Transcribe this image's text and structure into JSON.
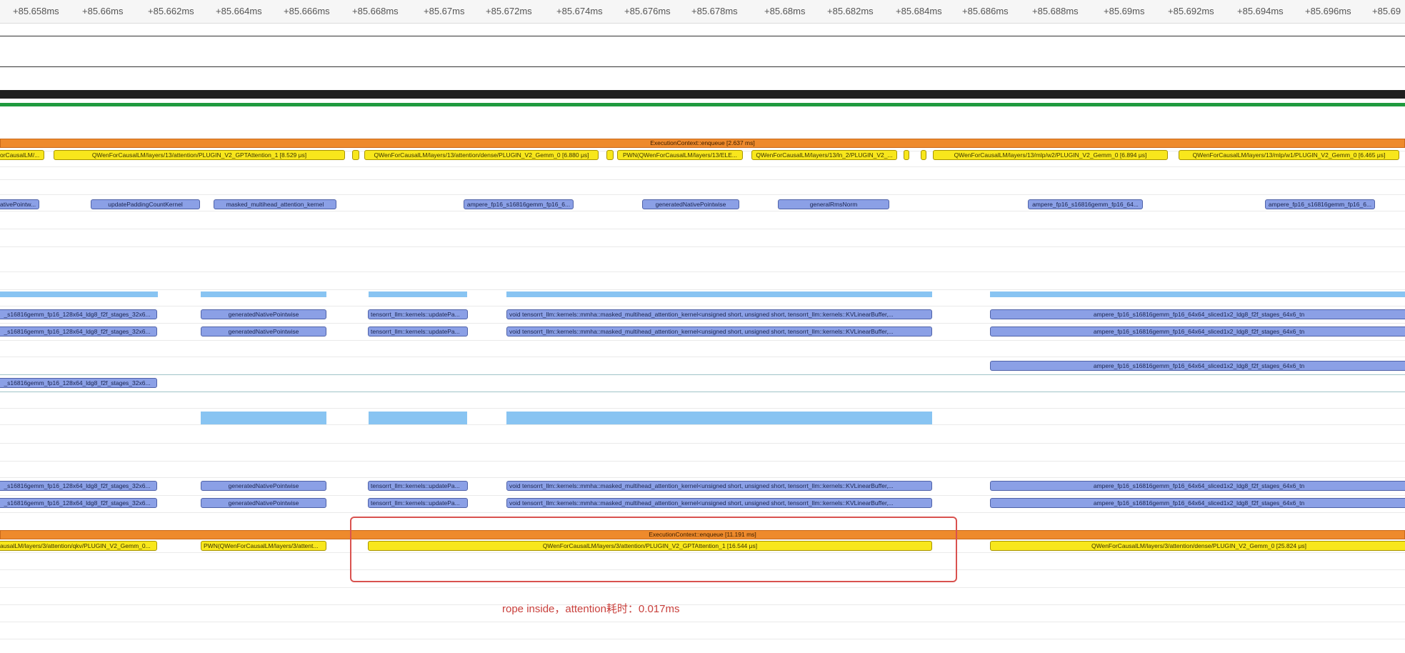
{
  "ruler": {
    "ticks": [
      "+85.658ms",
      "+85.66ms",
      "+85.662ms",
      "+85.664ms",
      "+85.666ms",
      "+85.668ms",
      "+85.67ms",
      "+85.672ms",
      "+85.674ms",
      "+85.676ms",
      "+85.678ms",
      "+85.68ms",
      "+85.682ms",
      "+85.684ms",
      "+85.686ms",
      "+85.688ms",
      "+85.69ms",
      "+85.692ms",
      "+85.694ms",
      "+85.696ms",
      "+85.69"
    ]
  },
  "lanes": {
    "enqueue_top": "ExecutionContext::enqueue [2.637 ms]",
    "layer13": [
      "orCausalLM/...",
      "QWenForCausalLM/layers/13/attention/PLUGIN_V2_GPTAttention_1 [8.529 μs]",
      "",
      "QWenForCausalLM/layers/13/attention/dense/PLUGIN_V2_Gemm_0 [6.880 μs]",
      "",
      "PWN(QWenForCausalLM/layers/13/ELE...",
      "QWenForCausalLM/layers/13/ln_2/PLUGIN_V2_...",
      "",
      "",
      "QWenForCausalLM/layers/13/mlp/w2/PLUGIN_V2_Gemm_0 [6.894 μs]",
      "QWenForCausalLM/layers/13/mlp/w1/PLUGIN_V2_Gemm_0 [6.465 μs]"
    ],
    "kernels": [
      "ativePointw...",
      "updatePaddingCountKernel",
      "masked_multihead_attention_kernel",
      "ampere_fp16_s16816gemm_fp16_6...",
      "generatedNativePointwise",
      "generalRmsNorm",
      "ampere_fp16_s16816gemm_fp16_64...",
      "ampere_fp16_s16816gemm_fp16_6..."
    ],
    "gpu_rows": [
      "_s16816gemm_fp16_128x64_ldg8_f2f_stages_32x6...",
      "generatedNativePointwise",
      "tensorrt_llm::kernels::updatePa...",
      "void tensorrt_llm::kernels::mmha::masked_multihead_attention_kernel<unsigned short, unsigned short, tensorrt_llm::kernels::KVLinearBuffer,...",
      "ampere_fp16_s16816gemm_fp16_64x64_sliced1x2_ldg8_f2f_stages_64x6_tn"
    ],
    "enqueue_bottom": "ExecutionContext::enqueue [11.191 ms]",
    "layer3": [
      "ausalLM/layers/3/attention/qkv/PLUGIN_V2_Gemm_0...",
      "PWN(QWenForCausalLM/layers/3/attent...",
      "QWenForCausalLM/layers/3/attention/PLUGIN_V2_GPTAttention_1 [16.544 μs]",
      "QWenForCausalLM/layers/3/attention/dense/PLUGIN_V2_Gemm_0 [25.824 μs]"
    ]
  },
  "annotation": {
    "text": "rope inside，attention耗时：0.017ms"
  },
  "colors": {
    "nvtx_yellow": "#f8e71c",
    "kernel_blue": "#8ba0e6",
    "enqueue_orange": "#ee8a2c",
    "mem_lightblue": "#88c4f2",
    "annotation_red": "#d9524f"
  }
}
